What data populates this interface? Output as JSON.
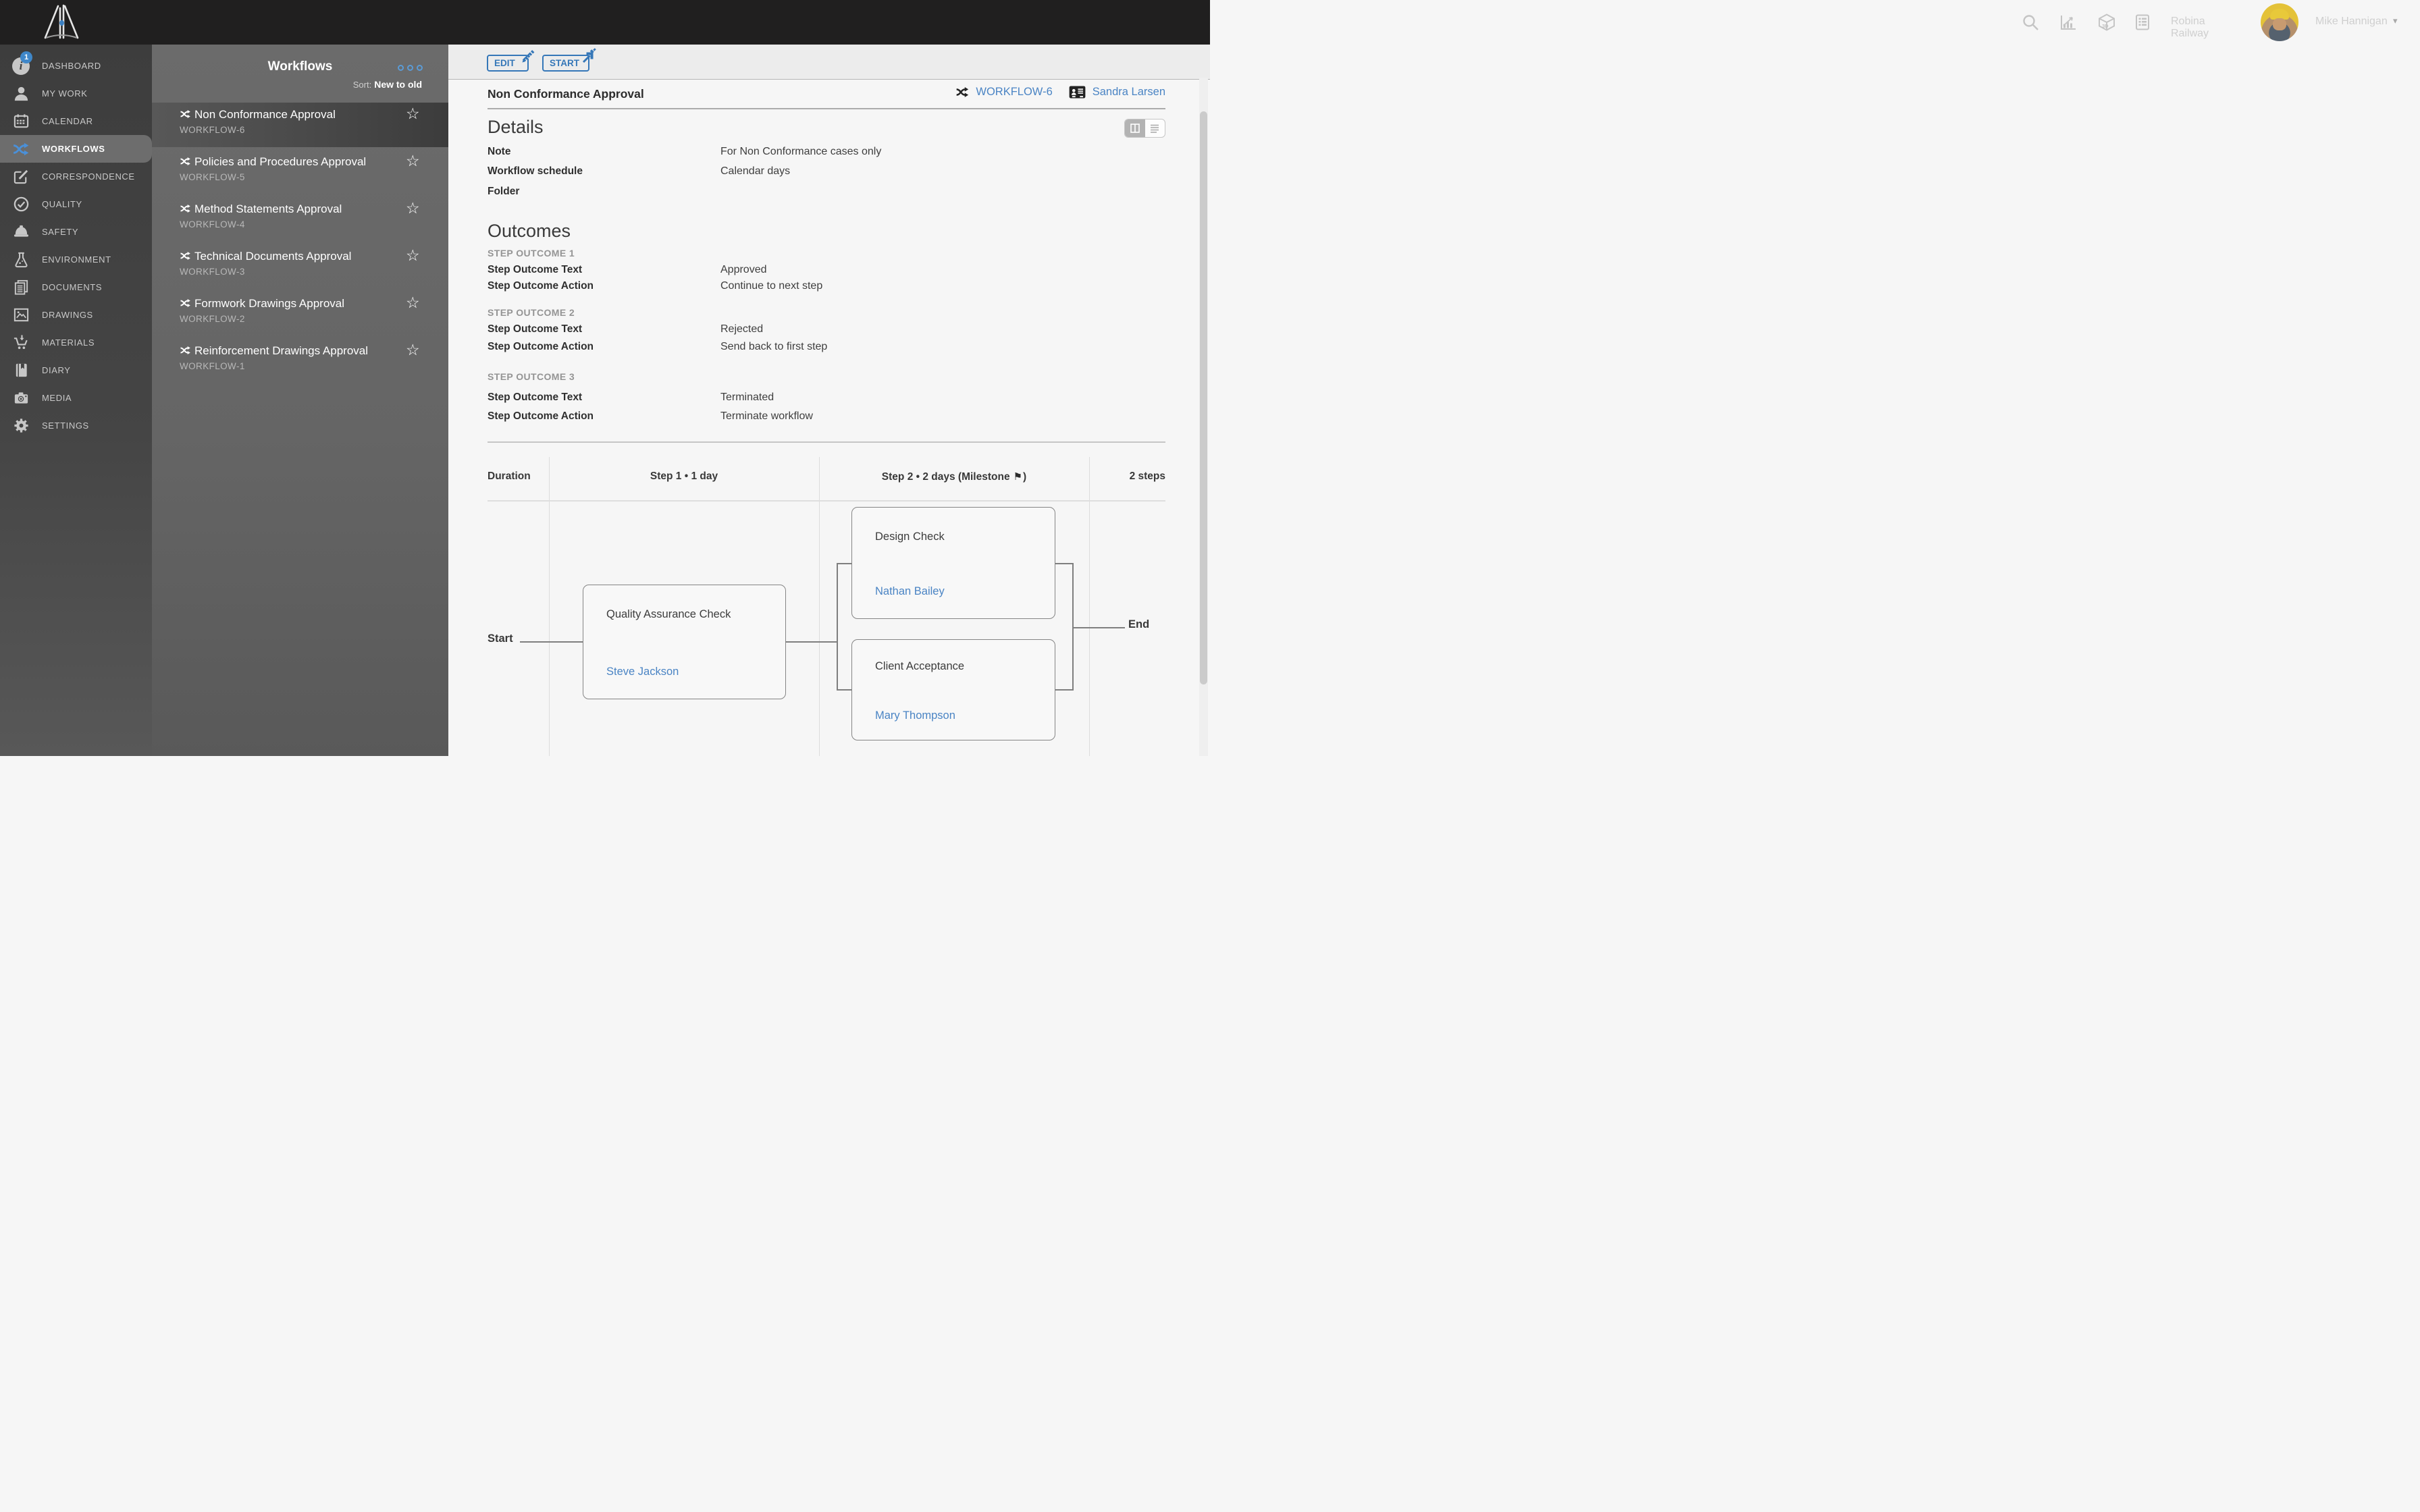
{
  "colors": {
    "accent_blue": "#3577b8",
    "link_blue": "#4a84c4",
    "active_icon_blue": "#4a90d9",
    "badge_blue": "#3f87c9"
  },
  "icons": {
    "star": "☆",
    "caret": "▾",
    "ellipsis_note": "more-menu"
  },
  "header": {
    "company": "Robina Railway",
    "user_name": "Mike Hannigan"
  },
  "sidebar": {
    "items": [
      {
        "label": "DASHBOARD",
        "badge": "1"
      },
      {
        "label": "MY WORK"
      },
      {
        "label": "CALENDAR"
      },
      {
        "label": "WORKFLOWS"
      },
      {
        "label": "CORRESPONDENCE"
      },
      {
        "label": "QUALITY"
      },
      {
        "label": "SAFETY"
      },
      {
        "label": "ENVIRONMENT"
      },
      {
        "label": "DOCUMENTS"
      },
      {
        "label": "DRAWINGS"
      },
      {
        "label": "MATERIALS"
      },
      {
        "label": "DIARY"
      },
      {
        "label": "MEDIA"
      },
      {
        "label": "SETTINGS"
      }
    ]
  },
  "panel": {
    "title": "Workflows",
    "sort_label": "Sort:",
    "sort_value": "New to old",
    "items": [
      {
        "title": "Non Conformance Approval",
        "code": "WORKFLOW-6"
      },
      {
        "title": "Policies and Procedures Approval",
        "code": "WORKFLOW-5"
      },
      {
        "title": "Method Statements Approval",
        "code": "WORKFLOW-4"
      },
      {
        "title": "Technical Documents Approval",
        "code": "WORKFLOW-3"
      },
      {
        "title": "Formwork Drawings Approval",
        "code": "WORKFLOW-2"
      },
      {
        "title": "Reinforcement Drawings Approval",
        "code": "WORKFLOW-1"
      }
    ]
  },
  "toolbar": {
    "edit_label": "EDIT",
    "start_label": "START"
  },
  "content": {
    "title": "Non Conformance Approval",
    "workflow_link": "WORKFLOW-6",
    "owner": "Sandra Larsen",
    "details": {
      "heading": "Details",
      "rows": [
        {
          "label": "Note",
          "value": "For Non Conformance cases only"
        },
        {
          "label": "Workflow schedule",
          "value": "Calendar days"
        },
        {
          "label": "Folder",
          "value": ""
        }
      ]
    },
    "outcomes": {
      "heading": "Outcomes",
      "row_labels": {
        "text": "Step Outcome Text",
        "action": "Step Outcome Action"
      },
      "groups": [
        {
          "heading": "STEP OUTCOME 1",
          "text": "Approved",
          "action": "Continue to next step"
        },
        {
          "heading": "STEP OUTCOME 2",
          "text": "Rejected",
          "action": "Send back to first step"
        },
        {
          "heading": "STEP OUTCOME 3",
          "text": "Terminated",
          "action": "Terminate workflow"
        }
      ]
    }
  },
  "diagram": {
    "duration_label": "Duration",
    "step1_header": "Step 1 • 1 day",
    "step2_header_prefix": "Step 2 • 2 days (Milestone",
    "milestone_flag_icon": "⚑",
    "step2_header_suffix": ")",
    "steps_summary": "2 steps",
    "start_label": "Start",
    "end_label": "End",
    "nodes": [
      {
        "title": "Quality Assurance Check",
        "assignee": "Steve Jackson"
      },
      {
        "title": "Design Check",
        "assignee": "Nathan Bailey"
      },
      {
        "title": "Client Acceptance",
        "assignee": "Mary Thompson"
      }
    ]
  }
}
